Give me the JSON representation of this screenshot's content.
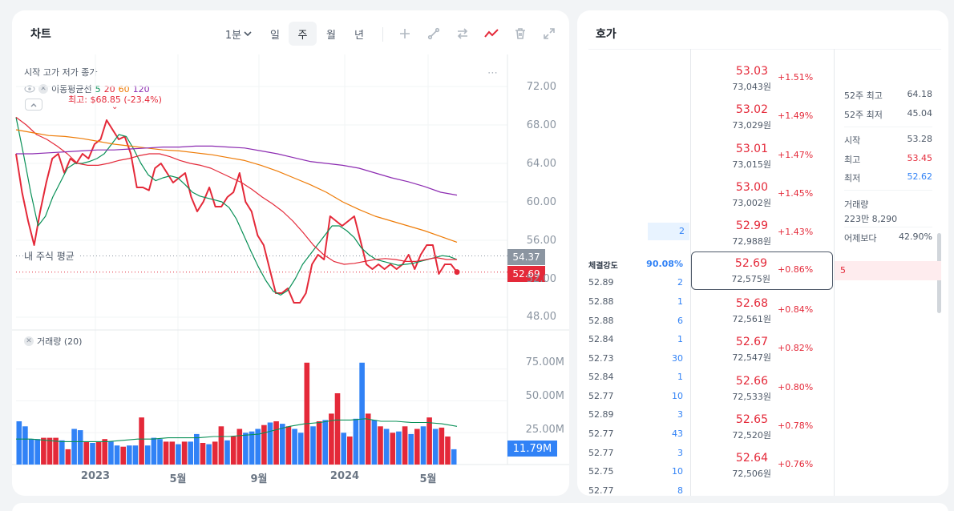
{
  "chart_panel": {
    "title": "차트",
    "toolbar": {
      "interval": "1분",
      "day": "일",
      "week": "주",
      "month": "월",
      "year": "년"
    },
    "ohlc_label": "시작 고가 저가 종가",
    "ma_label": "이동평균선",
    "ma_periods": [
      "5",
      "20",
      "60",
      "120"
    ],
    "high_label": "최고: $68.85 (-23.4%)",
    "avg_label": "내 주식 평균",
    "avg_tag": "54.37",
    "price_tag": "52.69",
    "volume_label": "거래량 (20)",
    "volume_tag": "11.79M",
    "more_icon": "⋯"
  },
  "chart_data": [
    {
      "type": "line",
      "title": "",
      "ylabel": "",
      "xlabel": "",
      "y_ticks": [
        "72.00",
        "68.00",
        "64.00",
        "60.00",
        "56.00",
        "52.00",
        "48.00"
      ],
      "x_ticks": [
        "2023",
        "5월",
        "9월",
        "2024",
        "5월"
      ],
      "ylim": [
        48,
        72
      ],
      "series": [
        {
          "name": "종가",
          "color": "#e42939",
          "values": [
            65.0,
            61.0,
            58.0,
            55.5,
            59.0,
            62.0,
            64.5,
            65.0,
            63.0,
            64.5,
            64.0,
            65.0,
            64.5,
            66.0,
            66.5,
            68.5,
            67.5,
            66.5,
            66.8,
            65.0,
            61.5,
            61.5,
            61.2,
            63.5,
            64.0,
            63.0,
            62.0,
            62.5,
            63.0,
            60.5,
            59.0,
            60.0,
            61.5,
            59.5,
            59.5,
            60.5,
            61.0,
            63.0,
            60.0,
            59.0,
            56.5,
            55.5,
            53.0,
            50.5,
            50.5,
            51.0,
            49.5,
            49.5,
            50.5,
            53.5,
            54.5,
            54.0,
            58.5,
            58.0,
            57.5,
            58.0,
            58.5,
            56.0,
            53.5,
            53.0,
            53.5,
            53.0,
            53.5,
            53.0,
            53.5,
            54.5,
            53.0,
            54.5,
            55.5,
            55.5,
            52.5,
            53.5,
            53.5,
            52.7
          ]
        },
        {
          "name": "5",
          "color": "#099057",
          "values": [
            68.8,
            65.0,
            61.0,
            57.5,
            58.5,
            60.5,
            62.0,
            63.5,
            64.0,
            64.0,
            64.2,
            64.5,
            65.0,
            66.0,
            67.0,
            66.8,
            65.5,
            64.0,
            62.8,
            62.2,
            62.5,
            62.7,
            62.5,
            61.8,
            61.0,
            60.6,
            60.4,
            60.2,
            60.0,
            59.4,
            58.2,
            56.5,
            54.8,
            53.2,
            51.8,
            50.7,
            50.3,
            50.8,
            52.0,
            53.5,
            54.5,
            55.5,
            56.5,
            57.5,
            57.5,
            57.0,
            56.3,
            55.2,
            54.5,
            54.0,
            53.8,
            53.6,
            53.4,
            53.5,
            53.6,
            53.8,
            54.0,
            54.2,
            54.4,
            54.3,
            54.0
          ]
        },
        {
          "name": "20",
          "color": "#e42939",
          "values": [
            68.8,
            68.0,
            67.0,
            66.5,
            65.8,
            65.0,
            64.0,
            63.8,
            63.8,
            64.0,
            64.3,
            64.5,
            64.8,
            65.0,
            65.0,
            64.7,
            64.3,
            64.0,
            63.8,
            63.5,
            63.0,
            62.5,
            62.0,
            61.3,
            60.5,
            59.8,
            59.0,
            58.0,
            56.8,
            55.5,
            54.5,
            53.8,
            53.5,
            53.6,
            53.8,
            54.0,
            54.1,
            54.0,
            53.8,
            53.8,
            54.0,
            54.2,
            54.0,
            54.0
          ]
        },
        {
          "name": "60",
          "color": "#ee7b06",
          "values": [
            67.5,
            67.2,
            66.9,
            66.8,
            66.6,
            66.3,
            66.0,
            65.8,
            65.6,
            65.4,
            65.3,
            65.1,
            64.9,
            64.6,
            64.3,
            63.8,
            63.2,
            62.5,
            61.8,
            61.0,
            60.0,
            59.2,
            58.5,
            58.0,
            57.5,
            57.0,
            56.4,
            55.8
          ]
        },
        {
          "name": "120",
          "color": "#8c2bb1",
          "values": [
            65.0,
            65.0,
            65.1,
            65.2,
            65.3,
            65.4,
            65.4,
            65.5,
            65.6,
            65.7,
            65.7,
            65.8,
            65.8,
            65.7,
            65.6,
            65.3,
            65.0,
            64.6,
            64.2,
            64.0,
            63.8,
            63.5,
            63.0,
            62.5,
            62.1,
            61.6,
            61.0,
            60.7
          ]
        }
      ]
    },
    {
      "type": "bar",
      "title": "",
      "ylabel": "",
      "y_ticks": [
        "75.00M",
        "50.00M",
        "25.00M"
      ],
      "ylim": [
        0,
        95
      ],
      "series": [
        {
          "name": "거래량 (20)",
          "values": [
            34,
            30,
            20,
            20,
            21,
            21,
            21,
            19,
            12,
            28,
            27,
            18,
            17,
            18,
            20,
            18,
            15,
            14,
            15,
            15,
            37,
            15,
            21,
            20,
            18,
            18,
            16,
            18,
            18,
            24,
            17,
            16,
            18,
            30,
            19,
            22,
            28,
            25,
            26,
            28,
            31,
            33,
            34,
            32,
            30,
            28,
            25,
            80,
            30,
            34,
            35,
            40,
            56,
            25,
            22,
            36,
            80,
            40,
            35,
            30,
            28,
            25,
            26,
            30,
            24,
            28,
            30,
            37,
            28,
            29,
            22,
            12
          ]
        },
        {
          "name": "20",
          "color": "#099057",
          "values": [
            20,
            20,
            19,
            18,
            18,
            18,
            18,
            19,
            20,
            20,
            21,
            21,
            21,
            22,
            22,
            23,
            24,
            27,
            30,
            32,
            33,
            35,
            35,
            36,
            34,
            34,
            33,
            33,
            32,
            30
          ]
        }
      ],
      "bar_colors": [
        "blue",
        "blue",
        "blue",
        "blue",
        "red",
        "red",
        "red",
        "blue",
        "red",
        "blue",
        "blue",
        "red",
        "blue",
        "red",
        "red",
        "blue",
        "blue",
        "red",
        "blue",
        "blue",
        "red",
        "blue",
        "blue",
        "blue",
        "red",
        "red",
        "blue",
        "red",
        "blue",
        "blue",
        "red",
        "blue",
        "red",
        "red",
        "blue",
        "red",
        "red",
        "blue",
        "blue",
        "blue",
        "red",
        "blue",
        "red",
        "blue",
        "red",
        "blue",
        "blue",
        "red",
        "blue",
        "red",
        "blue",
        "red",
        "red",
        "blue",
        "red",
        "blue",
        "blue",
        "red",
        "blue",
        "red",
        "blue",
        "red",
        "blue",
        "red",
        "blue",
        "red",
        "blue",
        "red",
        "blue",
        "red",
        "red",
        "blue"
      ]
    }
  ],
  "book_panel": {
    "title": "호가",
    "asks": [
      {
        "price": "53.03",
        "krw": "73,043원",
        "pct": "+1.51%"
      },
      {
        "price": "53.02",
        "krw": "73,029원",
        "pct": "+1.49%"
      },
      {
        "price": "53.01",
        "krw": "73,015원",
        "pct": "+1.47%"
      },
      {
        "price": "53.00",
        "krw": "73,002원",
        "pct": "+1.45%"
      },
      {
        "price": "52.99",
        "krw": "72,988원",
        "pct": "+1.43%",
        "qty": "2"
      }
    ],
    "current": {
      "price": "52.69",
      "krw": "72,575원",
      "pct": "+0.86%",
      "qty": "5"
    },
    "bids": [
      {
        "price": "52.68",
        "krw": "72,561원",
        "pct": "+0.84%"
      },
      {
        "price": "52.67",
        "krw": "72,547원",
        "pct": "+0.82%"
      },
      {
        "price": "52.66",
        "krw": "72,533원",
        "pct": "+0.80%"
      },
      {
        "price": "52.65",
        "krw": "72,520원",
        "pct": "+0.78%"
      },
      {
        "price": "52.64",
        "krw": "72,506원",
        "pct": "+0.76%"
      }
    ],
    "strength_label": "체결강도",
    "strength_value": "90.08%",
    "trades": [
      {
        "p": "52.89",
        "q": "2"
      },
      {
        "p": "52.88",
        "q": "1"
      },
      {
        "p": "52.88",
        "q": "6"
      },
      {
        "p": "52.84",
        "q": "1"
      },
      {
        "p": "52.73",
        "q": "30"
      },
      {
        "p": "52.84",
        "q": "1"
      },
      {
        "p": "52.77",
        "q": "10"
      },
      {
        "p": "52.89",
        "q": "3"
      },
      {
        "p": "52.77",
        "q": "43"
      },
      {
        "p": "52.77",
        "q": "3"
      },
      {
        "p": "52.75",
        "q": "10"
      },
      {
        "p": "52.77",
        "q": "8"
      }
    ],
    "info": {
      "w52_high_label": "52주 최고",
      "w52_high": "64.18",
      "w52_low_label": "52주 최저",
      "w52_low": "45.04",
      "open_label": "시작",
      "open": "53.28",
      "high_label": "최고",
      "high": "53.45",
      "low_label": "최저",
      "low": "52.62",
      "volume_label": "거래량",
      "volume": "223만 8,290",
      "vs_label": "어제보다",
      "vs": "42.90%"
    }
  },
  "colors": {
    "up": "#e42939",
    "down": "#3182f6",
    "ma5": "#099057",
    "ma20": "#e42939",
    "ma60": "#ee7b06",
    "ma120": "#8c2bb1"
  }
}
